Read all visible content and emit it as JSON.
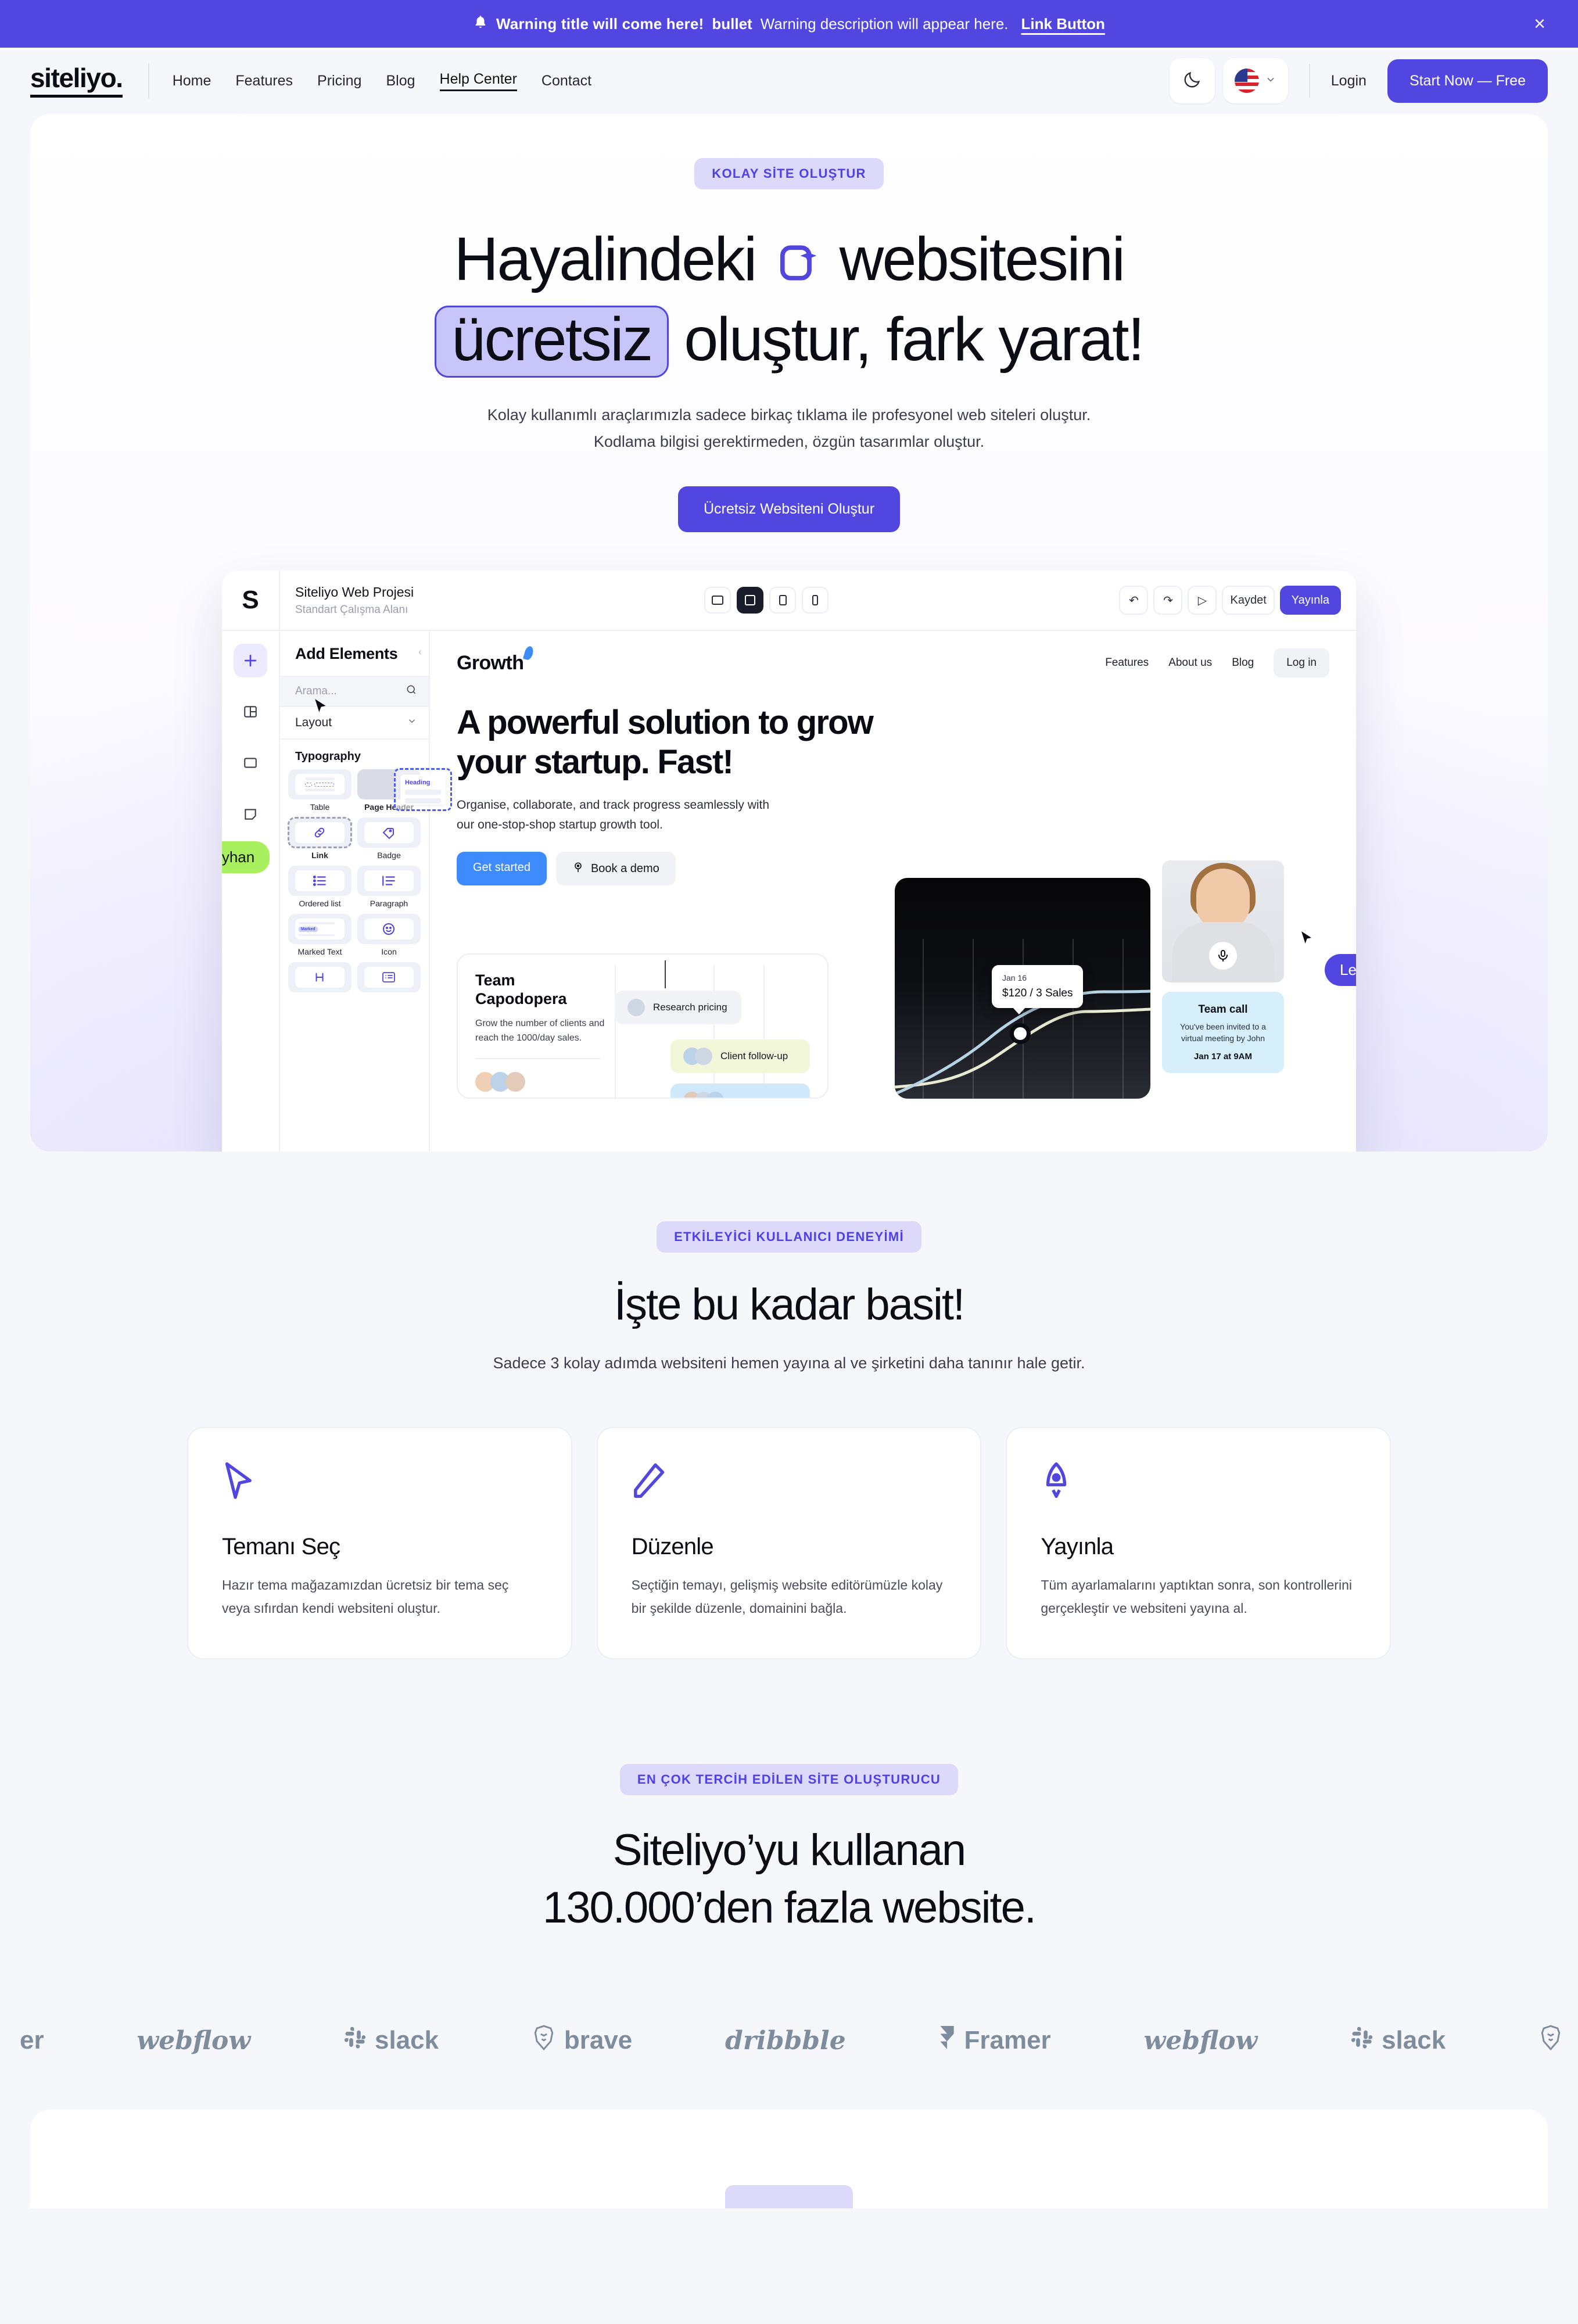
{
  "announcement": {
    "icon": "bell-icon",
    "title": "Warning title will come here!",
    "bullet": "bullet",
    "description": "Warning description will appear here.",
    "link_label": "Link Button",
    "close_label": "×",
    "bg_color": "#5147e0"
  },
  "header": {
    "logo": "siteliyo.",
    "nav": [
      {
        "label": "Home",
        "active": false
      },
      {
        "label": "Features",
        "active": false
      },
      {
        "label": "Pricing",
        "active": false
      },
      {
        "label": "Blog",
        "active": false
      },
      {
        "label": "Help Center",
        "active": true
      },
      {
        "label": "Contact",
        "active": false
      }
    ],
    "theme_toggle_icon": "moon-icon",
    "language_flag": "us-flag-icon",
    "language_chevron": "chevron-down-icon",
    "login_label": "Login",
    "cta_label": "Start Now — Free"
  },
  "hero": {
    "badge": "KOLAY SİTE OLUŞTUR",
    "title_part1": "Hayalindeki",
    "title_icon": "ai-website-icon",
    "title_part2": "websitesini",
    "highlight": "ücretsiz",
    "title_part3": "oluştur, fark yarat!",
    "subtitle_line1": "Kolay kullanımlı araçlarımızla sadece birkaç tıklama ile profesyonel web siteleri oluştur.",
    "subtitle_line2": "Kodlama bilgisi gerektirmeden, özgün tasarımlar oluştur.",
    "cta_label": "Ücretsiz Websiteni Oluştur",
    "accent_color": "#5147e0"
  },
  "editor": {
    "brand_letter": "S",
    "project_name": "Siteliyo Web Projesi",
    "workspace": "Standart Çalışma Alanı",
    "devices": [
      {
        "name": "tablet-landscape-icon",
        "active": false
      },
      {
        "name": "desktop-icon",
        "active": true
      },
      {
        "name": "tablet-portrait-icon",
        "active": false
      },
      {
        "name": "mobile-icon",
        "active": false
      }
    ],
    "actions": [
      {
        "name": "undo-icon",
        "label": "↶"
      },
      {
        "name": "redo-icon",
        "label": "↷"
      },
      {
        "name": "preview-icon",
        "label": "▷"
      }
    ],
    "save_label": "Kaydet",
    "publish_label": "Yayınla",
    "rail": [
      {
        "name": "add-icon",
        "glyph": "+",
        "active": true
      },
      {
        "name": "layout-grid-icon",
        "glyph": "▦",
        "active": false
      },
      {
        "name": "pages-icon",
        "glyph": "▭",
        "active": false
      },
      {
        "name": "theme-icon",
        "glyph": "◧",
        "active": false
      },
      {
        "name": "code-icon",
        "glyph": "<>",
        "active": false
      }
    ],
    "panel_title": "Add Elements",
    "search_placeholder": "Arama...",
    "search_icon": "search-icon",
    "group_layout": "Layout",
    "group_typography": "Typography",
    "elements": [
      {
        "label": "Table",
        "icon": "table-icon",
        "bold": false,
        "selected": false
      },
      {
        "label": "Page Header",
        "icon": "page-header-icon",
        "bold": true,
        "selected": false
      },
      {
        "label": "Link",
        "icon": "link-icon",
        "bold": true,
        "selected": true
      },
      {
        "label": "Badge",
        "icon": "badge-tag-icon",
        "bold": false,
        "selected": false
      },
      {
        "label": "Ordered list",
        "icon": "ordered-list-icon",
        "bold": false,
        "selected": false
      },
      {
        "label": "Paragraph",
        "icon": "paragraph-icon",
        "bold": false,
        "selected": false
      },
      {
        "label": "Marked Text",
        "icon": "marked-text-icon",
        "bold": false,
        "selected": false
      },
      {
        "label": "Icon",
        "icon": "emoji-icon",
        "bold": false,
        "selected": false
      },
      {
        "label": "",
        "icon": "heading-h-icon",
        "bold": false,
        "selected": false
      },
      {
        "label": "",
        "icon": "list-card-icon",
        "bold": false,
        "selected": false
      }
    ],
    "marked_text_sample": "Marked",
    "drag_ghost_label": "Heading",
    "collaborators": [
      {
        "name": "Çağatayhan",
        "color": "#a9f05f"
      },
      {
        "name": "Leyla",
        "color": "#5147e0"
      }
    ],
    "canvas": {
      "logo": "Growth",
      "nav": [
        "Features",
        "About us",
        "Blog"
      ],
      "login_label": "Log in",
      "headline_line1": "A powerful solution to grow",
      "headline_line2": "your startup. Fast!",
      "paragraph_line1": "Organise, collaborate, and track progress seamlessly with",
      "paragraph_line2": "our one-stop-shop startup growth tool.",
      "btn_primary": "Get started",
      "btn_secondary": "Book a demo",
      "btn_secondary_icon": "target-icon",
      "team_title_line1": "Team",
      "team_title_line2": "Capodopera",
      "team_sub_line1": "Grow the number of clients and",
      "team_sub_line2": "reach the 1000/day sales.",
      "tasks": [
        {
          "label": "Research pricing",
          "color": "#f2f3f6",
          "avatars": 1
        },
        {
          "label": "Client follow-up",
          "color": "#f2f7d9",
          "avatars": 2
        },
        {
          "label": "",
          "color": "#cfe9fa",
          "avatars": 3
        }
      ],
      "chart": {
        "tooltip_date": "Jan 16",
        "tooltip_value": "$120 / 3 Sales"
      },
      "person_mic_icon": "microphone-icon",
      "call_title": "Team call",
      "call_body_line1": "You've been invited to a",
      "call_body_line2": "virtual meeting by John",
      "call_time": "Jan 17 at 9AM"
    }
  },
  "simple_section": {
    "badge": "ETKİLEYİCİ KULLANICI DENEYİMİ",
    "title": "İşte bu kadar basit!",
    "subtitle": "Sadece 3 kolay adımda websiteni hemen yayına al ve şirketini daha tanınır hale getir.",
    "cards": [
      {
        "icon": "cursor-arrow-icon",
        "title": "Temanı Seç",
        "body": "Hazır tema mağazamızdan ücretsiz bir tema seç veya sıfırdan kendi websiteni oluştur."
      },
      {
        "icon": "pencil-edit-icon",
        "title": "Düzenle",
        "body": "Seçtiğin temayı, gelişmiş website editörümüzle kolay bir şekilde düzenle, domainini bağla."
      },
      {
        "icon": "rocket-icon",
        "title": "Yayınla",
        "body": "Tüm ayarlamalarını yaptıktan sonra, son kontrollerini gerçekleştir ve websiteni yayına al."
      }
    ]
  },
  "stats_section": {
    "badge": "EN ÇOK TERCİH EDİLEN SİTE OLUŞTURUCU",
    "title_line1": "Siteliyo’yu kullanan",
    "title_line2": "130.000’den fazla website."
  },
  "logo_marquee": {
    "items": [
      {
        "name": "framer-logo",
        "label": "er",
        "style": "plain",
        "icon": ""
      },
      {
        "name": "webflow-logo",
        "label": "webflow",
        "style": "script",
        "icon": ""
      },
      {
        "name": "slack-logo",
        "label": "slack",
        "style": "plain",
        "icon": "slack-icon"
      },
      {
        "name": "brave-logo",
        "label": "brave",
        "style": "plain",
        "icon": "brave-lion-icon"
      },
      {
        "name": "dribbble-logo",
        "label": "dribbble",
        "style": "script",
        "icon": ""
      },
      {
        "name": "framer-logo",
        "label": "Framer",
        "style": "plain",
        "icon": "framer-icon"
      },
      {
        "name": "webflow-logo",
        "label": "webflow",
        "style": "script",
        "icon": ""
      },
      {
        "name": "slack-logo",
        "label": "slack",
        "style": "plain",
        "icon": "slack-icon"
      },
      {
        "name": "brave-logo",
        "label": "",
        "style": "plain",
        "icon": "brave-lion-icon"
      }
    ]
  }
}
